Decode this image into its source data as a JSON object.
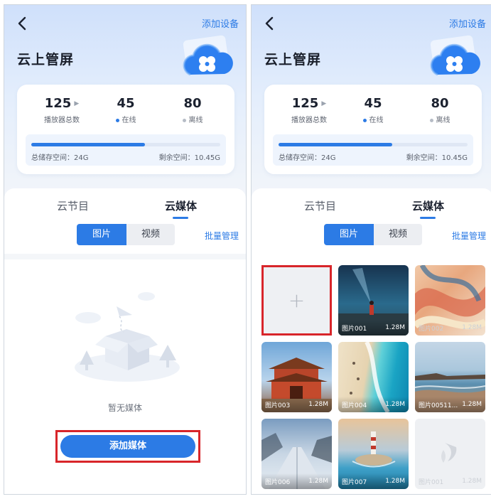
{
  "header": {
    "title": "云上管屏",
    "add_device": "添加设备"
  },
  "stats": {
    "total": {
      "value": "125",
      "label": "播放器总数"
    },
    "online": {
      "value": "45",
      "label": "在线",
      "color": "#2c7be5"
    },
    "offline": {
      "value": "80",
      "label": "离线",
      "color": "#b6bcc6"
    }
  },
  "storage": {
    "total_label": "总储存空间：24G",
    "remaining_label": "剩余空间：10.45G",
    "used_fraction": 0.6
  },
  "tabs": [
    {
      "label": "云节目"
    },
    {
      "label": "云媒体"
    }
  ],
  "segments": {
    "image": "图片",
    "video": "视频"
  },
  "batch_manage": "批量管理",
  "empty": {
    "text": "暂无媒体",
    "button": "添加媒体"
  },
  "media": {
    "add_symbol": "+",
    "items": [
      {
        "name": "图片001",
        "size": "1.28M"
      },
      {
        "name": "图片002",
        "size": "1.28M"
      },
      {
        "name": "图片003",
        "size": "1.28M"
      },
      {
        "name": "图片004",
        "size": "1.28M"
      },
      {
        "name": "图片00511...",
        "size": "1.28M"
      },
      {
        "name": "图片006",
        "size": "1.28M"
      },
      {
        "name": "图片007",
        "size": "1.28M"
      },
      {
        "name": "图片001",
        "size": "1.28M"
      }
    ]
  },
  "colors": {
    "accent": "#2c7be5",
    "highlight_border": "#d8252a"
  }
}
